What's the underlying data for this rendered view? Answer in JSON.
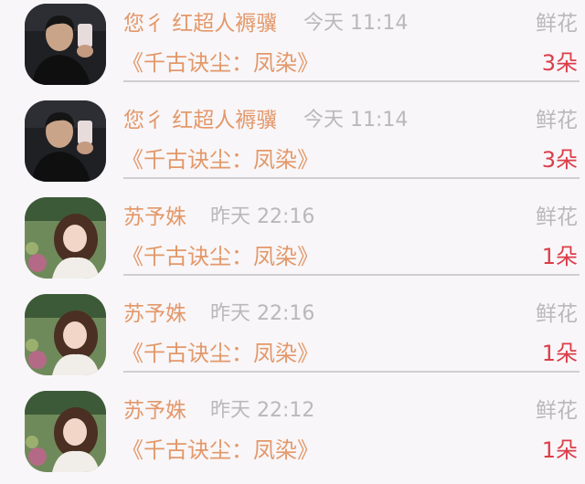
{
  "records": [
    {
      "name": "您彳 红超人褥骥",
      "time": "今天 11:14",
      "gift": "鲜花",
      "book": "《千古诀尘：凤染》",
      "count": "3朵",
      "avatar": "man-avatar"
    },
    {
      "name": "您彳 红超人褥骥",
      "time": "今天 11:14",
      "gift": "鲜花",
      "book": "《千古诀尘：凤染》",
      "count": "3朵",
      "avatar": "man-avatar"
    },
    {
      "name": "苏予姝",
      "time": "昨天 22:16",
      "gift": "鲜花",
      "book": "《千古诀尘：凤染》",
      "count": "1朵",
      "avatar": "woman-avatar"
    },
    {
      "name": "苏予姝",
      "time": "昨天 22:16",
      "gift": "鲜花",
      "book": "《千古诀尘：凤染》",
      "count": "1朵",
      "avatar": "woman-avatar"
    },
    {
      "name": "苏予姝",
      "time": "昨天 22:12",
      "gift": "鲜花",
      "book": "《千古诀尘：凤染》",
      "count": "1朵",
      "avatar": "woman-avatar"
    }
  ],
  "colors": {
    "name": "#e3986a",
    "muted": "#b9b9b9",
    "count": "#dc3d4a",
    "background": "#f8f6f8"
  }
}
